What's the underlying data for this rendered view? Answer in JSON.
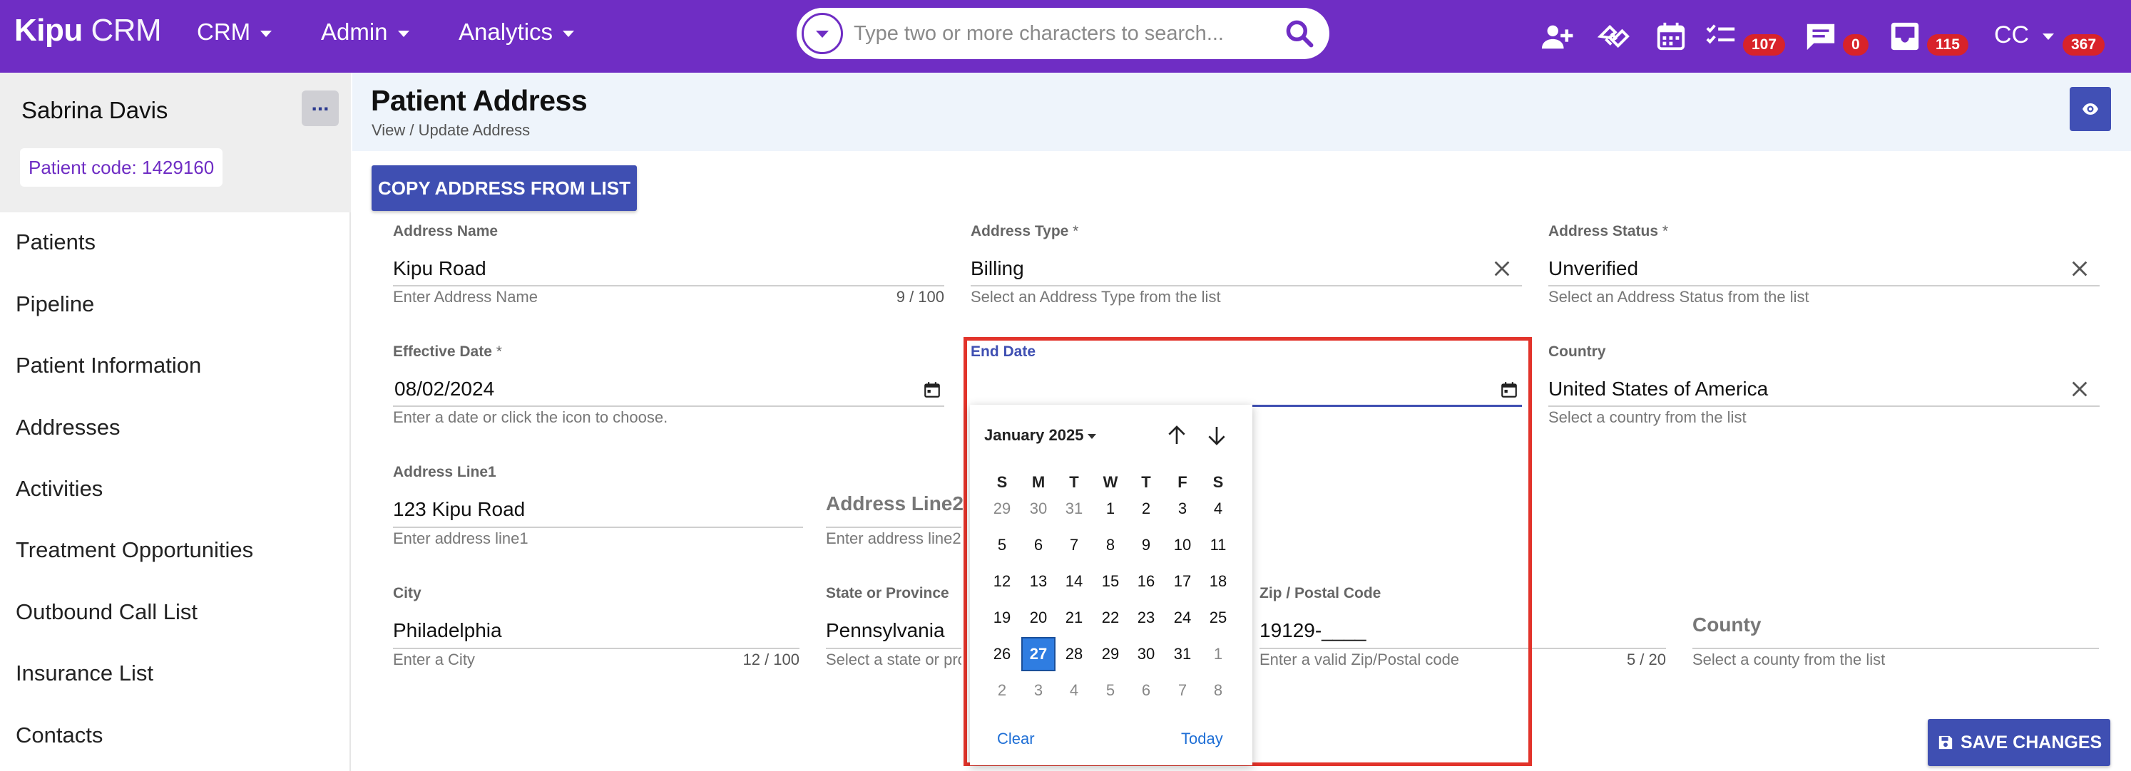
{
  "app": {
    "brand_strong": "Kipu",
    "brand_rest": " CRM",
    "nav": [
      "CRM",
      "Admin",
      "Analytics"
    ],
    "search_placeholder": "Type two or more characters to search...",
    "badges": {
      "tasks": "107",
      "messages": "0",
      "inbox": "115",
      "user": "367"
    },
    "user_initials": "CC",
    "icons": [
      "add-user-icon",
      "handshake-icon",
      "calendar-icon",
      "checklist-icon",
      "message-icon",
      "inbox-icon"
    ]
  },
  "sidebar": {
    "patient_name": "Sabrina Davis",
    "more_label": "...",
    "patient_code": "Patient code: 1429160",
    "items": [
      "Patients",
      "Pipeline",
      "Patient Information",
      "Addresses",
      "Activities",
      "Treatment Opportunities",
      "Outbound Call List",
      "Insurance List",
      "Contacts"
    ]
  },
  "header": {
    "title": "Patient Address",
    "subtitle": "View / Update Address"
  },
  "actions": {
    "copy_label": "COPY ADDRESS FROM LIST",
    "save_label": "SAVE CHANGES"
  },
  "form": {
    "address_name": {
      "label": "Address Name",
      "value": "Kipu Road",
      "hint": "Enter Address Name",
      "count": "9 / 100"
    },
    "address_type": {
      "label": "Address Type",
      "required": " *",
      "value": "Billing",
      "hint": "Select an Address Type from the list"
    },
    "address_status": {
      "label": "Address Status",
      "required": " *",
      "value": "Unverified",
      "hint": "Select an Address Status from the list"
    },
    "effective_date": {
      "label": "Effective Date",
      "required": " *",
      "value": "08/02/2024",
      "hint": "Enter a date or click the icon to choose."
    },
    "end_date": {
      "label": "End Date",
      "value": ""
    },
    "country": {
      "label": "Country",
      "value": "United States of America",
      "hint": "Select a country from the list"
    },
    "address_line1": {
      "label": "Address Line1",
      "value": "123 Kipu Road",
      "hint": "Enter address line1"
    },
    "address_line2": {
      "label": "Address Line2",
      "hint": "Enter address line2"
    },
    "city": {
      "label": "City",
      "value": "Philadelphia",
      "hint": "Enter a City",
      "count": "12 / 100"
    },
    "state": {
      "label": "State or Province",
      "value": "Pennsylvania",
      "hint": "Select a state or province"
    },
    "zip": {
      "label": "Zip / Postal Code",
      "value": "19129-____",
      "hint": "Enter a valid Zip/Postal code",
      "count": "5 / 20"
    },
    "county": {
      "label": "County",
      "hint": "Select a county from the list"
    }
  },
  "datepicker": {
    "month_label": "January 2025",
    "weekdays": [
      "S",
      "M",
      "T",
      "W",
      "T",
      "F",
      "S"
    ],
    "weeks": [
      [
        "29",
        "30",
        "31",
        "1",
        "2",
        "3",
        "4"
      ],
      [
        "5",
        "6",
        "7",
        "8",
        "9",
        "10",
        "11"
      ],
      [
        "12",
        "13",
        "14",
        "15",
        "16",
        "17",
        "18"
      ],
      [
        "19",
        "20",
        "21",
        "22",
        "23",
        "24",
        "25"
      ],
      [
        "26",
        "27",
        "28",
        "29",
        "30",
        "31",
        "1"
      ],
      [
        "2",
        "3",
        "4",
        "5",
        "6",
        "7",
        "8"
      ]
    ],
    "selected_day": "27",
    "clear_label": "Clear",
    "today_label": "Today"
  },
  "colors": {
    "brand": "#6f2dc4",
    "primary": "#3f4fb2",
    "badge": "#d8232a",
    "highlight": "#e2332a",
    "selected_day": "#2f7de1"
  }
}
